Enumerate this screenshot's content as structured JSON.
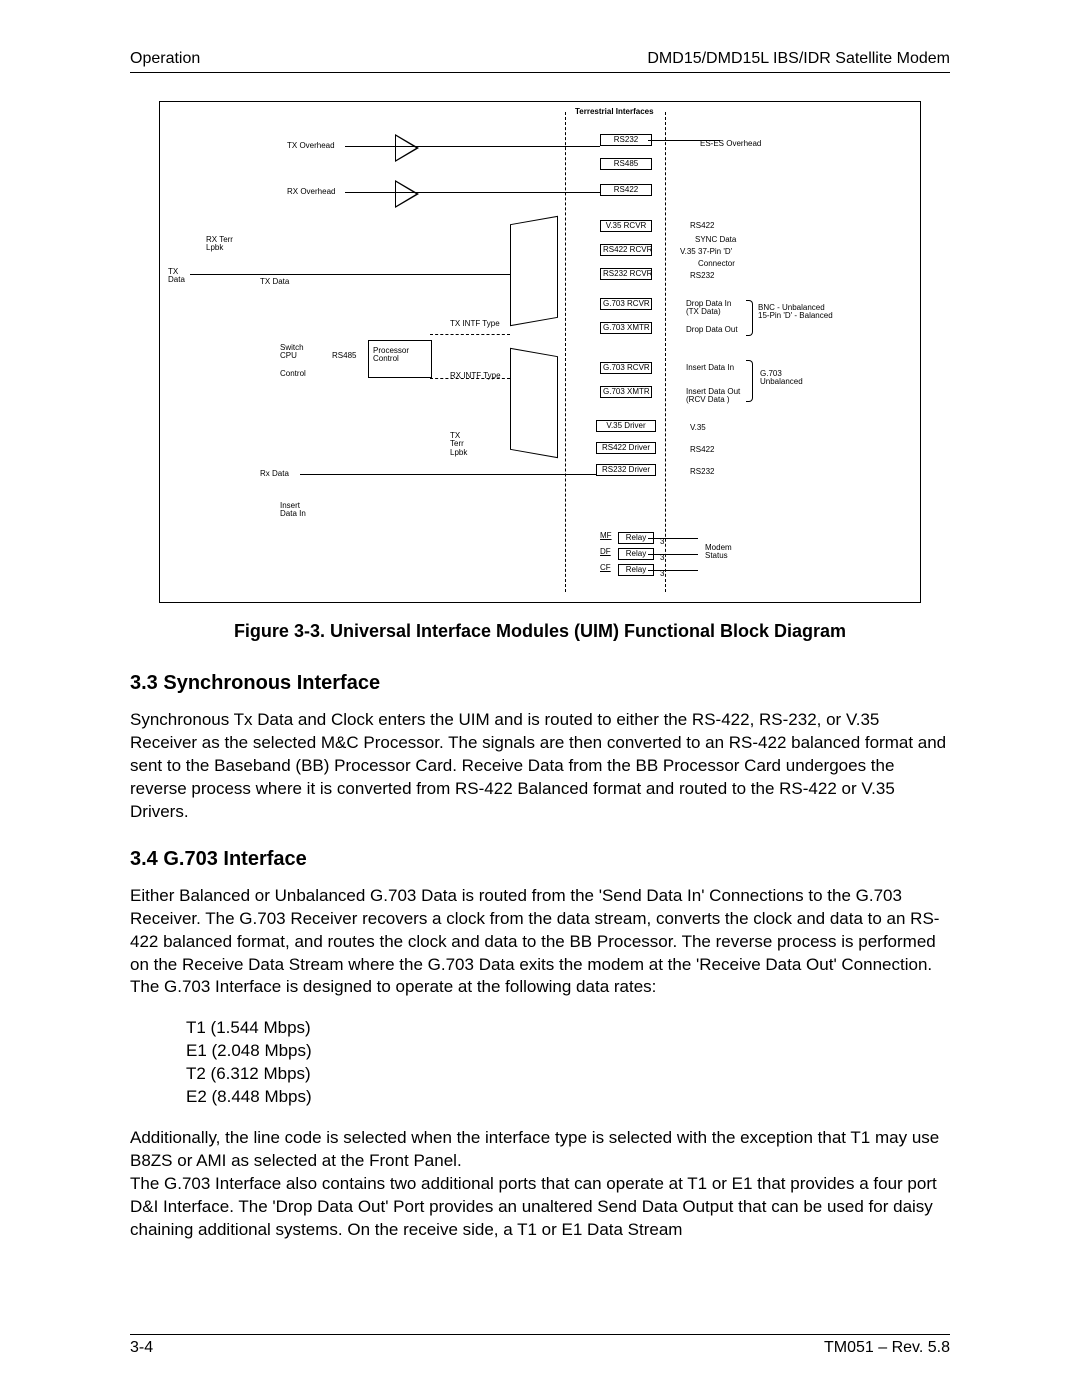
{
  "header": {
    "left": "Operation",
    "right": "DMD15/DMD15L IBS/IDR Satellite Modem"
  },
  "figure": {
    "caption": "Figure 3-3.  Universal Interface Modules (UIM) Functional Block Diagram",
    "top_label": "Terrestrial Interfaces",
    "left_labels": {
      "tx_overhead": "TX Overhead",
      "rx_overhead": "RX Overhead",
      "rx_terr_lpbk": "RX Terr\nLpbk",
      "tx_data": "TX\nData",
      "tx_data2": "TX Data",
      "switch_cpu": "Switch\nCPU",
      "control": "Control",
      "rs485": "RS485",
      "rx_data": "Rx Data",
      "insert_data_in": "Insert\nData In"
    },
    "center_labels": {
      "processor_control": "Processor\nControl",
      "tx_intf_type": "TX INTF Type",
      "rx_intf_type": "RX INTF Type",
      "tx_terr_lpbk": "TX\nTerr\nLpbk",
      "mf": "MF",
      "df": "DF",
      "cf": "CF",
      "relay": "Relay",
      "three": "3"
    },
    "boxes": {
      "rs232": "RS232",
      "rs485": "RS485",
      "rs422": "RS422",
      "v35_rcvr": "V.35\nRCVR",
      "rs422_rcvr": "RS422\nRCVR",
      "rs232_rcvr": "RS232\nRCVR",
      "g703_rcvr": "G.703\nRCVR",
      "g703_xmtr": "G.703\nXMTR",
      "v35_driver": "V.35 Driver",
      "rs422_driver": "RS422 Driver",
      "rs232_driver": "RS232 Driver"
    },
    "right_labels": {
      "es_es_overhead": "ES-ES  Overhead",
      "rs422": "RS422",
      "sync_data": "SYNC Data",
      "v35": "V.35",
      "pin37": "37-Pin 'D'",
      "connector": "Connector",
      "rs232": "RS232",
      "drop_data_in": "Drop Data In\n(TX Data)",
      "drop_data_out": "Drop Data Out",
      "bnc": "BNC - Unbalanced\n15-Pin 'D' - Balanced",
      "insert_data_in": "Insert Data In",
      "g703_unbalanced": "G.703\nUnbalanced",
      "insert_data_out": "Insert Data Out\n(RCV Data )",
      "v35_r": "V.35",
      "rs422_r": "RS422",
      "rs232_r": "RS232",
      "modem_status": "Modem\nStatus"
    }
  },
  "section33": {
    "heading": "3.3  Synchronous Interface",
    "body": "Synchronous Tx Data and Clock enters the UIM and is routed to either the RS-422, RS-232, or V.35 Receiver as the selected M&C Processor.  The signals are then converted to an RS-422 balanced format and sent to the Baseband (BB) Processor Card.  Receive Data from the BB Processor Card undergoes the reverse process where it is converted from RS-422 Balanced format and routed to the RS-422 or V.35 Drivers."
  },
  "section34": {
    "heading": "3.4  G.703 Interface",
    "body1": "Either Balanced or Unbalanced G.703 Data is routed from the 'Send Data In' Connections to the G.703 Receiver.  The G.703 Receiver recovers a clock from the data stream, converts the clock and data to an RS-422 balanced format, and routes the clock and data to the BB Processor.  The reverse process is performed on the Receive Data Stream where the G.703 Data exits the modem at the 'Receive Data Out' Connection.  The G.703 Interface is designed to operate at the following data rates:",
    "rates": {
      "r1": "T1 (1.544 Mbps)",
      "r2": "E1 (2.048 Mbps)",
      "r3": "T2 (6.312 Mbps)",
      "r4": "E2 (8.448 Mbps)"
    },
    "body2": "Additionally, the line code is selected when the interface type is selected with the exception that T1 may use B8ZS or AMI as selected at the Front Panel.\nThe G.703 Interface also contains two additional ports that can operate at T1 or E1 that provides a four port D&I Interface.  The 'Drop Data Out' Port provides an unaltered Send Data Output that can be used for daisy chaining additional systems.  On the receive side, a T1 or E1 Data Stream"
  },
  "footer": {
    "left": "3-4",
    "right": "TM051 – Rev. 5.8"
  }
}
